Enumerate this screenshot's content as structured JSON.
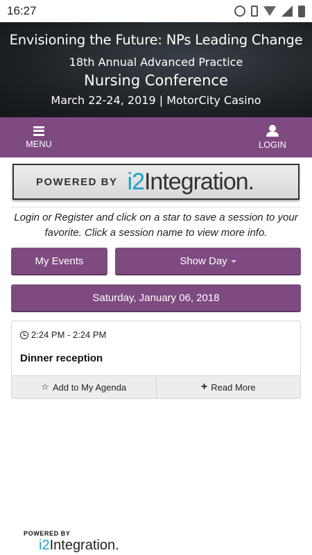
{
  "status_bar": {
    "time": "16:27"
  },
  "banner": {
    "line1": "Envisioning the Future: NPs Leading Change",
    "line2": "18th Annual Advanced Practice",
    "line3": "Nursing Conference",
    "line4": "March 22-24, 2019 | MotorCity Casino"
  },
  "nav": {
    "menu_label": "MENU",
    "login_label": "LOGIN"
  },
  "logo": {
    "powered_by": "POWERED BY",
    "brand_prefix": "i2",
    "brand_suffix": "Integration."
  },
  "instructions": "Login or Register and click on a star to save a session to your favorite. Click a session name to view more info.",
  "buttons": {
    "my_events": "My Events",
    "show_day": "Show Day"
  },
  "date_header": "Saturday, January 06, 2018",
  "session": {
    "time": "2:24 PM - 2:24 PM",
    "title": "Dinner reception",
    "add_agenda_label": "Add to My Agenda",
    "read_more_label": "Read More"
  },
  "footer": {
    "powered_by": "POWERED BY",
    "brand_prefix": "i2",
    "brand_suffix": "Integration."
  },
  "colors": {
    "primary": "#7e4a80",
    "brand_blue": "#1aa3c8"
  }
}
